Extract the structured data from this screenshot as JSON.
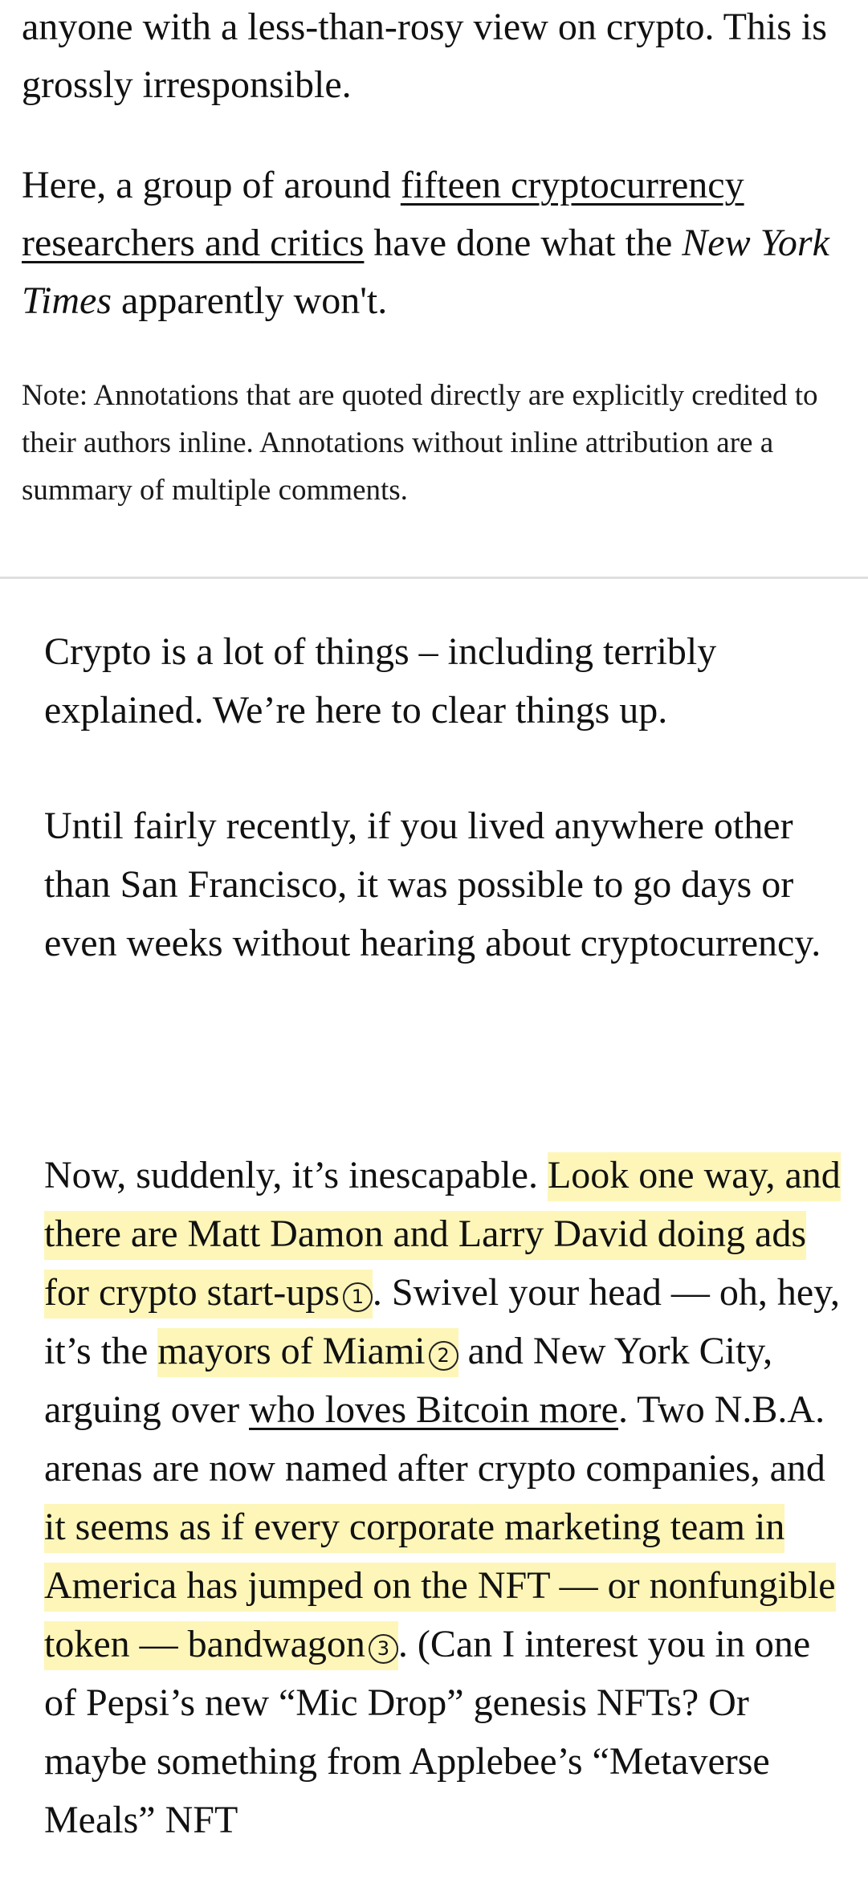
{
  "intro": {
    "para1": "anyone with a less-than-rosy view on crypto. This is grossly irresponsible.",
    "para2_before": "Here, a group of around ",
    "para2_link": "fifteen cryptocurrency researchers and critics",
    "para2_mid": " have done what the ",
    "para2_em": "New York Times",
    "para2_after": " apparently won't.",
    "note": "Note: Annotations that are quoted directly are explicitly credited to their authors inline. Annotations without inline attribution are a summary of multiple comments."
  },
  "article": {
    "p1": "Crypto is a lot of things – including terribly explained. We’re here to clear things up.",
    "p2": "Until fairly recently, if you lived anywhere other than San Francisco, it was possible to go days or even weeks without hearing about cryptocurrency.",
    "p3": {
      "t1": "Now, suddenly, it’s inescapable. ",
      "h1": "Look one way, and there are Matt Damon and Larry David doing ads for crypto start-ups",
      "n1": "1",
      "t2": ". Swivel your head — oh, hey, it’s the ",
      "h2": "mayors of Miami",
      "n2": "2",
      "t3": " and New York City, arguing over ",
      "link": "who loves Bitcoin more",
      "t4": ". Two N.B.A. arenas are now named after crypto companies, and ",
      "h3": "it seems as if every corporate marketing team in America has jumped on the NFT — or nonfungible token — bandwagon",
      "n3": "3",
      "t5": ". (Can I interest you in one of Pepsi’s new “Mic Drop” genesis NFTs? Or maybe something from Applebee’s “Metaverse Meals” NFT"
    }
  },
  "colors": {
    "highlight": "#fdf6b8",
    "text": "#111111",
    "divider": "#dedede"
  }
}
